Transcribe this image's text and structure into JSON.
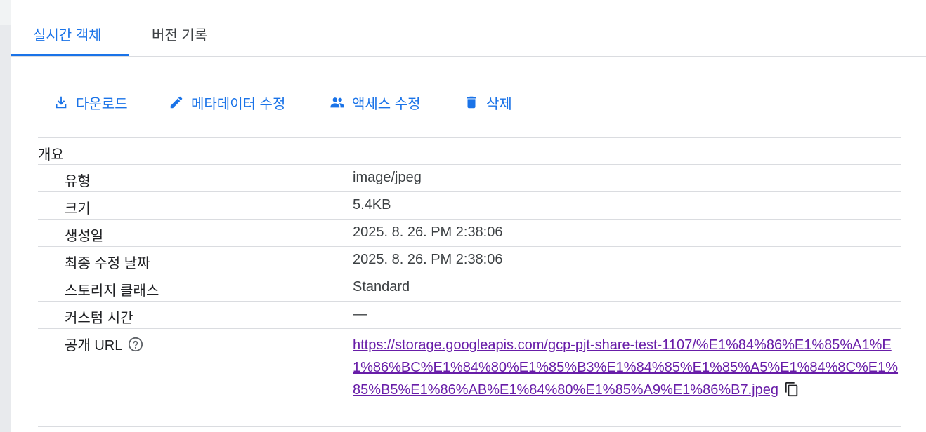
{
  "tabs": [
    {
      "label": "실시간 객체",
      "active": true
    },
    {
      "label": "버전 기록",
      "active": false
    }
  ],
  "actions": {
    "download": {
      "label": "다운로드",
      "icon": "download-icon"
    },
    "edit_metadata": {
      "label": "메타데이터 수정",
      "icon": "pencil-icon"
    },
    "edit_access": {
      "label": "액세스 수정",
      "icon": "people-icon"
    },
    "delete": {
      "label": "삭제",
      "icon": "trash-icon"
    }
  },
  "overview": {
    "section_title": "개요",
    "rows": [
      {
        "label": "유형",
        "value": "image/jpeg"
      },
      {
        "label": "크기",
        "value": "5.4KB"
      },
      {
        "label": "생성일",
        "value": "2025. 8. 26. PM 2:38:06"
      },
      {
        "label": "최종 수정 날짜",
        "value": "2025. 8. 26. PM 2:38:06"
      },
      {
        "label": "스토리지 클래스",
        "value": "Standard"
      },
      {
        "label": "커스텀 시간",
        "value": "—"
      }
    ],
    "public_url": {
      "label": "공개 URL",
      "value": "https://storage.googleapis.com/gcp-pjt-share-test-1107/%E1%84%86%E1%85%A1%E1%86%BC%E1%84%80%E1%85%B3%E1%84%85%E1%85%A5%E1%84%8C%E1%85%B5%E1%86%AB%E1%84%80%E1%85%A9%E1%86%B7.jpeg",
      "help_icon": "help-icon",
      "copy_icon": "copy-icon"
    }
  },
  "colors": {
    "accent": "#1a73e8",
    "link_visited": "#681da8",
    "divider": "#dadce0"
  }
}
